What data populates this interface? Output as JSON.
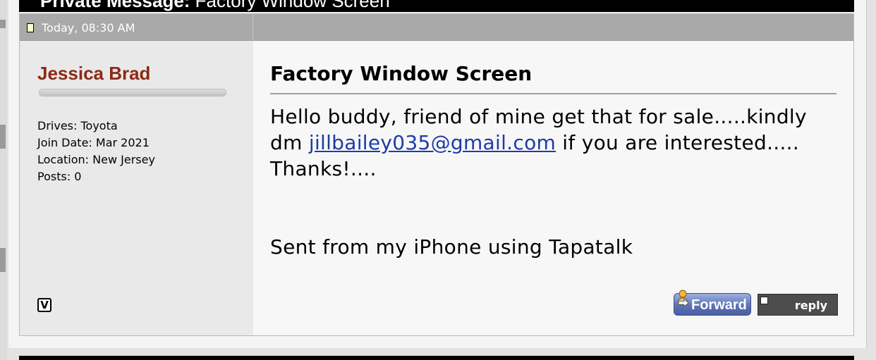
{
  "page_header": {
    "title": "Private Message:",
    "subtitle": " Factory Window Screen"
  },
  "post": {
    "date": "Today, 08:30 AM",
    "user": {
      "name": "Jessica Brad",
      "drives": "Drives: Toyota",
      "join_date": "Join Date: Mar 2021",
      "location": "Location: New Jersey",
      "posts": "Posts: 0"
    },
    "message": {
      "title": "Factory Window Screen",
      "body_before": "Hello buddy, friend of mine get that for sale.....kindly dm ",
      "email": "jillbailey035@gmail.com",
      "body_after": " if you are interested..... Thanks!....",
      "signature": "Sent from my iPhone using Tapatalk"
    },
    "actions": {
      "forward_label": "Forward",
      "reply_label": "reply"
    }
  },
  "icons": {
    "post_icon": "document-icon",
    "vb_icon": "v-icon",
    "forward_icon": "user-forward-icon",
    "reply_icon": "reply-arrow-icon"
  },
  "colors": {
    "username": "#8c2a15",
    "header_bar": "#a9a9a9",
    "link": "#1f3ba6",
    "forward_button": "#5d72b8",
    "reply_button": "#4d4d4d"
  }
}
